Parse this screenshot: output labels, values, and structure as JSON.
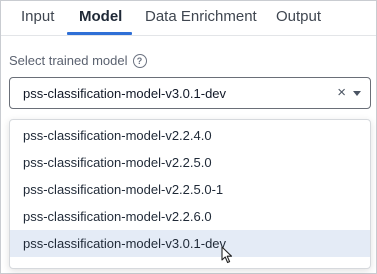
{
  "tabs": [
    {
      "label": "Input"
    },
    {
      "label": "Model"
    },
    {
      "label": "Data Enrichment"
    },
    {
      "label": "Output"
    }
  ],
  "active_tab": "Model",
  "model_select": {
    "label": "Select trained model",
    "help_icon": "?",
    "value": "pss-classification-model-v3.0.1-dev",
    "clear_icon": "×",
    "options": [
      {
        "label": "pss-classification-model-v2.2.4.0"
      },
      {
        "label": "pss-classification-model-v2.2.5.0"
      },
      {
        "label": "pss-classification-model-v2.2.5.0-1"
      },
      {
        "label": "pss-classification-model-v2.2.6.0"
      },
      {
        "label": "pss-classification-model-v3.0.1-dev"
      }
    ],
    "selected_option": "pss-classification-model-v3.0.1-dev"
  },
  "colors": {
    "accent": "#2f6fd6",
    "selected_option_bg": "#e4ebf6",
    "border": "#6a6f78"
  },
  "icons": {
    "help": "help-circle-icon",
    "clear": "close-icon",
    "dropdown": "caret-down-icon",
    "cursor": "mouse-pointer-icon"
  }
}
